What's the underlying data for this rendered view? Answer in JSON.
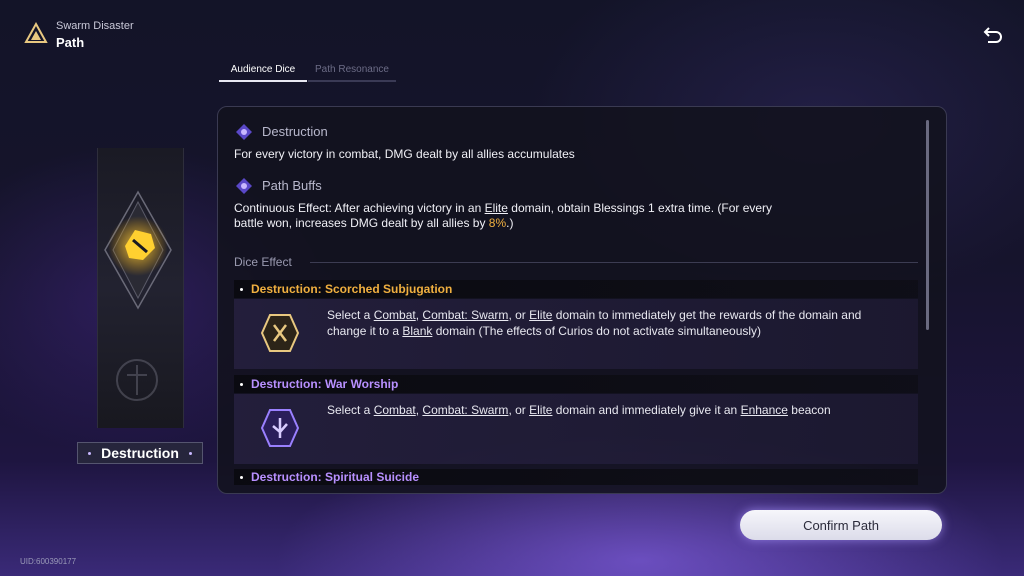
{
  "header": {
    "subtitle": "Swarm Disaster",
    "title": "Path"
  },
  "tabs": [
    {
      "label": "Audience Dice",
      "active": true
    },
    {
      "label": "Path Resonance",
      "active": false
    }
  ],
  "path": {
    "name": "Destruction"
  },
  "panel": {
    "section1": {
      "title": "Destruction",
      "text": "For every victory in combat, DMG dealt by all allies accumulates"
    },
    "section2": {
      "title": "Path Buffs",
      "text_a": "Continuous Effect: After achieving victory in an ",
      "text_link": "Elite",
      "text_b": " domain, obtain Blessings 1 extra time. (For every",
      "text_c": "battle won, increases DMG dealt by all allies by ",
      "text_pct": "8%",
      "text_d": ".)"
    },
    "dice_label": "Dice Effect",
    "entries": [
      {
        "title": "Destruction: Scorched Subjugation",
        "p1": "Select a ",
        "l1": "Combat",
        "p2": ", ",
        "l2": "Combat: Swarm",
        "p3": ", or ",
        "l3": "Elite",
        "p4": " domain to immediately get the rewards of the domain and change it to a ",
        "l4": "Blank",
        "p5": " domain (The effects of Curios do not activate simultaneously)"
      },
      {
        "title": "Destruction: War Worship",
        "p1": "Select a ",
        "l1": "Combat",
        "p2": ", ",
        "l2": "Combat: Swarm",
        "p3": ", or ",
        "l3": "Elite",
        "p4": " domain and immediately give it an ",
        "l4": "Enhance",
        "p5": " beacon"
      },
      {
        "title": "Destruction: Spiritual Suicide"
      }
    ]
  },
  "confirm_label": "Confirm Path",
  "uid": "UID:600390177",
  "colors": {
    "gold": "#f0b040",
    "purple": "#b890ff"
  }
}
